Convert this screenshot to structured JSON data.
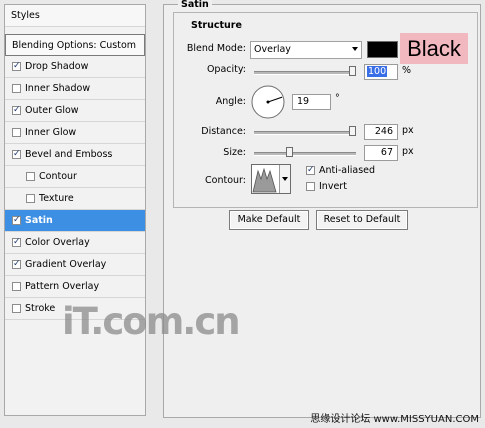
{
  "styles_panel": {
    "header": "Styles",
    "blending_options": "Blending Options: Custom",
    "items": [
      {
        "label": "Drop Shadow",
        "checked": true,
        "indent": false,
        "selected": false
      },
      {
        "label": "Inner Shadow",
        "checked": false,
        "indent": false,
        "selected": false
      },
      {
        "label": "Outer Glow",
        "checked": true,
        "indent": false,
        "selected": false
      },
      {
        "label": "Inner Glow",
        "checked": false,
        "indent": false,
        "selected": false
      },
      {
        "label": "Bevel and Emboss",
        "checked": true,
        "indent": false,
        "selected": false
      },
      {
        "label": "Contour",
        "checked": false,
        "indent": true,
        "selected": false
      },
      {
        "label": "Texture",
        "checked": false,
        "indent": true,
        "selected": false
      },
      {
        "label": "Satin",
        "checked": true,
        "indent": false,
        "selected": true
      },
      {
        "label": "Color Overlay",
        "checked": true,
        "indent": false,
        "selected": false
      },
      {
        "label": "Gradient Overlay",
        "checked": true,
        "indent": false,
        "selected": false
      },
      {
        "label": "Pattern Overlay",
        "checked": false,
        "indent": false,
        "selected": false
      },
      {
        "label": "Stroke",
        "checked": false,
        "indent": false,
        "selected": false
      }
    ]
  },
  "satin": {
    "title": "Satin",
    "structure_title": "Structure",
    "blend_mode_label": "Blend Mode:",
    "blend_mode_value": "Overlay",
    "color_swatch": "#000000",
    "color_annotation": "Black",
    "opacity_label": "Opacity:",
    "opacity_value": "100",
    "opacity_fraction": 1.0,
    "percent_unit": "%",
    "angle_label": "Angle:",
    "angle_value": "19",
    "degree_unit": "°",
    "distance_label": "Distance:",
    "distance_value": "246",
    "distance_fraction": 1.0,
    "size_label": "Size:",
    "size_value": "67",
    "size_fraction": 0.34,
    "px_unit": "px",
    "contour_label": "Contour:",
    "anti_aliased_label": "Anti-aliased",
    "anti_aliased_checked": true,
    "invert_label": "Invert",
    "invert_checked": false
  },
  "buttons": {
    "make_default": "Make Default",
    "reset_to_default": "Reset to Default"
  },
  "watermarks": {
    "logo": "iT.com.cn",
    "footer": "思缘设计论坛 www.MISSYUAN.COM"
  },
  "colors": {
    "selected_row": "#3d8fe3",
    "annotation_bg": "#f2b8bf",
    "highlight_input": "#3a6ee6"
  }
}
